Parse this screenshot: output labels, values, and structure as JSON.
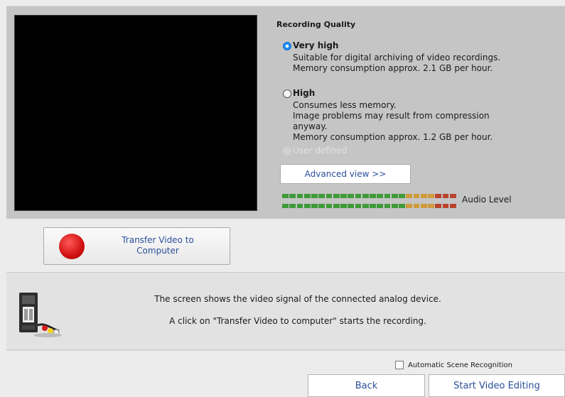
{
  "recording_quality": {
    "title": "Recording Quality",
    "options": [
      {
        "label": "Very high",
        "selected": true,
        "lines": [
          "Suitable for digital archiving of video recordings.",
          "Memory consumption approx. 2.1 GB per hour."
        ]
      },
      {
        "label": "High",
        "selected": false,
        "lines": [
          "Consumes less memory.",
          "Image problems may result from compression anyway.",
          "Memory consumption approx. 1.2 GB per hour."
        ]
      },
      {
        "label": "User defined",
        "selected": false,
        "disabled": true
      }
    ],
    "advanced_label": "Advanced view >>"
  },
  "audio": {
    "label": "Audio Level",
    "colors": {
      "green": "#3f9a3a",
      "orange": "#d09a3c",
      "red": "#b8442e",
      "dark": "#5a5a5a"
    }
  },
  "transfer_button": {
    "label": "Transfer Video to Computer",
    "icon": "record-dot-icon",
    "color": "#d01010"
  },
  "info": {
    "icon": "vhs-cassette-icon",
    "line1": "The screen shows the video signal of the connected analog device.",
    "line2": "A click on \"Transfer Video to computer\" starts the recording."
  },
  "scene_recognition": {
    "label": "Automatic Scene Recognition",
    "checked": false
  },
  "footer": {
    "back_label": "Back",
    "start_label": "Start Video Editing"
  },
  "colors": {
    "panel": "#c5c5c5",
    "accent_text": "#2a4f9a",
    "radio_selected": "#1a8cff"
  }
}
